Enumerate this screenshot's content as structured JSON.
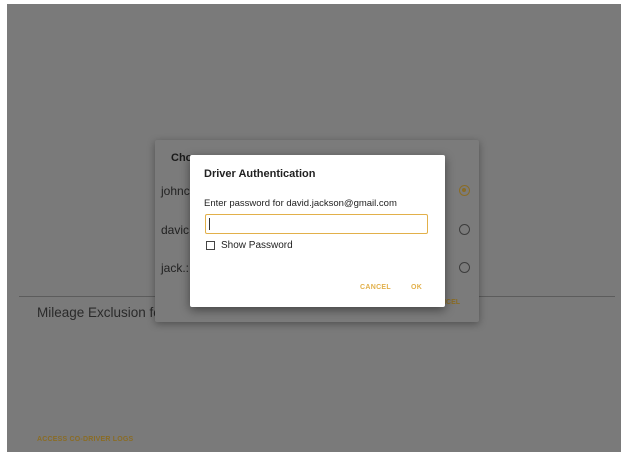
{
  "background": {
    "mileage_exclusion_label": "Mileage Exclusion for",
    "access_co_driver_logs": "ACCESS CO-DRIVER LOGS"
  },
  "choose_dialog": {
    "title": "Cho",
    "drivers": [
      {
        "label": "johnc",
        "selected": true
      },
      {
        "label": "davic",
        "selected": false
      },
      {
        "label": "jack.:",
        "selected": false
      }
    ],
    "cancel_label": "NCEL"
  },
  "auth_dialog": {
    "title": "Driver Authentication",
    "prompt": "Enter password for david.jackson@gmail.com",
    "password_value": "",
    "show_password_label": "Show Password",
    "show_password_checked": false,
    "cancel_label": "CANCEL",
    "ok_label": "OK"
  },
  "colors": {
    "accent": "#e2b04a",
    "accent_dimmed": "#8a6c25",
    "overlay": "#7a7a7a"
  }
}
